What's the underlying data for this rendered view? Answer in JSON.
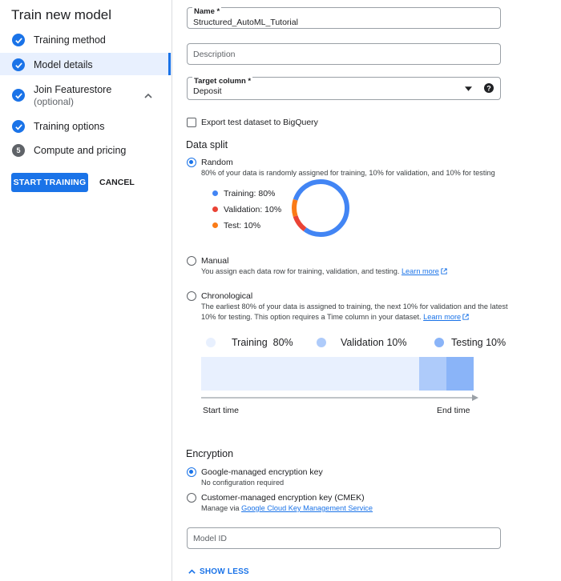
{
  "sidebar": {
    "title": "Train new model",
    "steps": [
      {
        "label": "Training method",
        "state": "done"
      },
      {
        "label": "Model details",
        "state": "active"
      },
      {
        "label": "Join Featurestore",
        "sub": "(optional)",
        "state": "done"
      },
      {
        "label": "Training options",
        "state": "done"
      },
      {
        "label": "Compute and pricing",
        "number": "5",
        "state": "pending"
      }
    ],
    "start_button": "START TRAINING",
    "cancel_button": "CANCEL"
  },
  "form": {
    "name": {
      "label": "Name *",
      "value": "Structured_AutoML_Tutorial"
    },
    "description": {
      "placeholder": "Description"
    },
    "target_column": {
      "label": "Target column *",
      "value": "Deposit"
    },
    "export_checkbox": {
      "label": "Export test dataset to BigQuery",
      "checked": false
    }
  },
  "data_split": {
    "heading": "Data split",
    "random": {
      "label": "Random",
      "selected": true,
      "description": "80% of your data is randomly assigned for training, 10% for validation, and 10% for testing",
      "legend": [
        {
          "label": "Training: 80%",
          "value": 80,
          "color": "#4285f4"
        },
        {
          "label": "Validation: 10%",
          "value": 10,
          "color": "#ea4335"
        },
        {
          "label": "Test: 10%",
          "value": 10,
          "color": "#fa7b17"
        }
      ]
    },
    "manual": {
      "label": "Manual",
      "selected": false,
      "description": "You assign each data row for training, validation, and testing.",
      "link": "Learn more"
    },
    "chronological": {
      "label": "Chronological",
      "selected": false,
      "description_line1": "The earliest 80% of your data is assigned to training, the next 10% for validation and the latest",
      "description_line2": "10% for testing. This option requires a Time column in your dataset.",
      "link": "Learn more",
      "legend": [
        {
          "name": "Training",
          "pct": "80%",
          "value": 80,
          "color": "#e8f0fe"
        },
        {
          "name": "Validation",
          "pct": "10%",
          "value": 10,
          "color": "#aecbfa"
        },
        {
          "name": "Testing",
          "pct": "10%",
          "value": 10,
          "color": "#8ab4f8"
        }
      ],
      "start_label": "Start time",
      "end_label": "End time"
    }
  },
  "encryption": {
    "heading": "Encryption",
    "google": {
      "label": "Google-managed encryption key",
      "sub": "No configuration required",
      "selected": true
    },
    "cmek": {
      "label": "Customer-managed encryption key (CMEK)",
      "sub_prefix": "Manage via",
      "link": "Google Cloud Key Management Service",
      "selected": false
    }
  },
  "model_id": {
    "placeholder": "Model ID"
  },
  "show_less": "SHOW LESS"
}
